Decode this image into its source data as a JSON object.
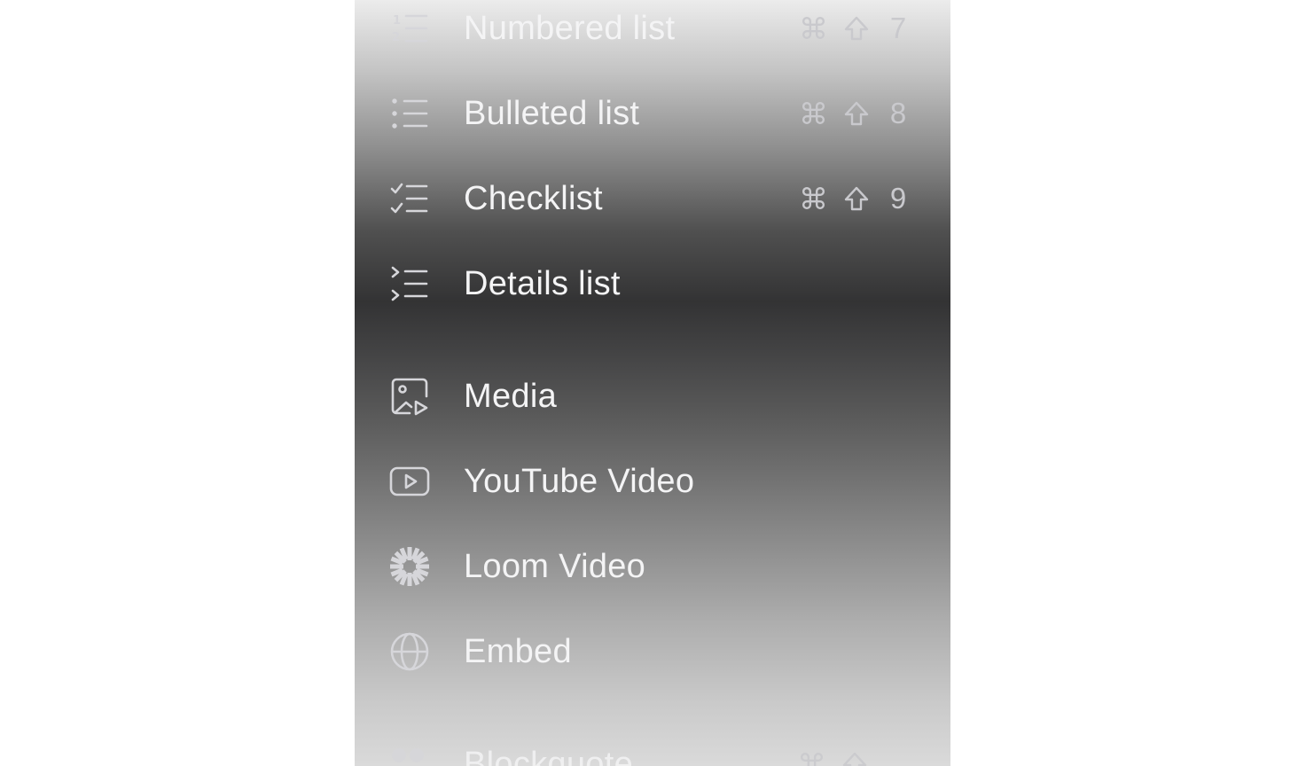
{
  "menu": {
    "items": [
      {
        "label": "Numbered list",
        "icon": "numbered-list-icon",
        "shortcut": {
          "cmd": "⌘",
          "shift": "shift-arrow-icon",
          "key": "7"
        }
      },
      {
        "label": "Bulleted list",
        "icon": "bulleted-list-icon",
        "shortcut": {
          "cmd": "⌘",
          "shift": "shift-arrow-icon",
          "key": "8"
        }
      },
      {
        "label": "Checklist",
        "icon": "checklist-icon",
        "shortcut": {
          "cmd": "⌘",
          "shift": "shift-arrow-icon",
          "key": "9"
        }
      },
      {
        "label": "Details list",
        "icon": "details-list-icon"
      },
      {
        "label": "Media",
        "icon": "media-icon"
      },
      {
        "label": "YouTube Video",
        "icon": "youtube-icon"
      },
      {
        "label": "Loom Video",
        "icon": "loom-icon"
      },
      {
        "label": "Embed",
        "icon": "globe-icon"
      },
      {
        "label": "Blockquote",
        "icon": "quote-icon",
        "shortcut": {
          "cmd": "⌘",
          "shift": "shift-arrow-icon"
        }
      }
    ]
  }
}
